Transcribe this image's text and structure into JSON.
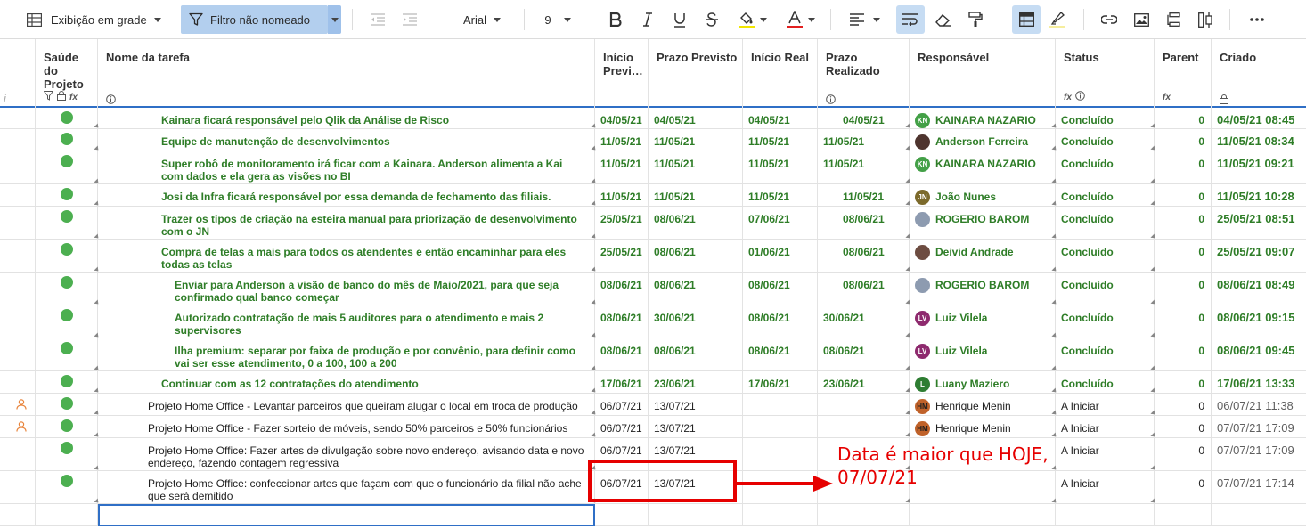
{
  "toolbar": {
    "view_label": "Exibição em grade",
    "filter_label": "Filtro não nomeado",
    "font_name": "Arial",
    "font_size": "9"
  },
  "columns": {
    "health": "Saúde do Projeto",
    "task": "Nome da tarefa",
    "inicio_previsto": "Início Previ…",
    "prazo_previsto": "Prazo Previsto",
    "inicio_real": "Início Real",
    "prazo_realizado": "Prazo Realizado",
    "responsavel": "Responsável",
    "status": "Status",
    "parent": "Parent",
    "criado": "Criado"
  },
  "colors": {
    "green_text": "#2e7d27",
    "health_green": "#4caf50",
    "selection_blue": "#2f6fc6",
    "annotation_red": "#e60000"
  },
  "rows": [
    {
      "task": "Kainara ficará responsável pelo Qlik da Análise de Risco",
      "indent": 1,
      "ip": "04/05/21",
      "pp": "04/05/21",
      "ir": "04/05/21",
      "pr": "04/05/21",
      "resp": "KAINARA NAZARIO",
      "initials": "KN",
      "avatar_color": "#43a047",
      "status": "Concluído",
      "parent": "0",
      "created": "04/05/21 08:45",
      "style": "green",
      "height": 24,
      "user_icon": false
    },
    {
      "task": "Equipe de manutenção de desenvolvimentos",
      "indent": 1,
      "ip": "11/05/21",
      "pp": "11/05/21",
      "ir": "11/05/21",
      "pr": "11/05/21",
      "resp": "Anderson Ferreira",
      "initials": "",
      "avatar_color": "#4e342e",
      "status": "Concluído",
      "parent": "0",
      "created": "11/05/21 08:34",
      "style": "green",
      "height": 25,
      "user_icon": false
    },
    {
      "task": "Super robô de monitoramento irá ficar com a Kainara. Anderson alimenta a Kai com dados e ela gera as visões no BI",
      "indent": 1,
      "ip": "11/05/21",
      "pp": "11/05/21",
      "ir": "11/05/21",
      "pr": "11/05/21",
      "resp": "KAINARA NAZARIO",
      "initials": "KN",
      "avatar_color": "#43a047",
      "status": "Concluído",
      "parent": "0",
      "created": "11/05/21 09:21",
      "style": "green",
      "height": 37,
      "user_icon": false
    },
    {
      "task": "Josi da Infra ficará responsável por essa demanda de fechamento das filiais.",
      "indent": 1,
      "ip": "11/05/21",
      "pp": "11/05/21",
      "ir": "11/05/21",
      "pr": "11/05/21",
      "resp": "João Nunes",
      "initials": "JN",
      "avatar_color": "#7c6a2c",
      "status": "Concluído",
      "parent": "0",
      "created": "11/05/21 10:28",
      "style": "green",
      "height": 25,
      "user_icon": false
    },
    {
      "task": "Trazer os tipos de criação na esteira manual para priorização de desenvolvimento com o JN",
      "indent": 1,
      "ip": "25/05/21",
      "pp": "08/06/21",
      "ir": "07/06/21",
      "pr": "08/06/21",
      "resp": "ROGERIO BAROM",
      "initials": "",
      "avatar_color": "#8d9bb0",
      "status": "Concluído",
      "parent": "0",
      "created": "25/05/21 08:51",
      "style": "green",
      "height": 37,
      "user_icon": false
    },
    {
      "task": "Compra de telas a mais para todos os atendentes e então encaminhar para eles todas as telas",
      "indent": 1,
      "ip": "25/05/21",
      "pp": "08/06/21",
      "ir": "01/06/21",
      "pr": "08/06/21",
      "resp": "Deivid Andrade",
      "initials": "",
      "avatar_color": "#6d4c41",
      "status": "Concluído",
      "parent": "0",
      "created": "25/05/21 09:07",
      "style": "green",
      "height": 37,
      "user_icon": false
    },
    {
      "task": "Enviar para Anderson a visão de banco do mês de Maio/2021, para que seja confirmado qual banco começar",
      "indent": 2,
      "ip": "08/06/21",
      "pp": "08/06/21",
      "ir": "08/06/21",
      "pr": "08/06/21",
      "resp": "ROGERIO BAROM",
      "initials": "",
      "avatar_color": "#8d9bb0",
      "status": "Concluído",
      "parent": "0",
      "created": "08/06/21 08:49",
      "style": "green",
      "height": 37,
      "user_icon": false
    },
    {
      "task": "Autorizado contratação de mais 5 auditores para o atendimento e mais 2 supervisores",
      "indent": 2,
      "ip": "08/06/21",
      "pp": "30/06/21",
      "ir": "08/06/21",
      "pr": "30/06/21",
      "resp": "Luiz Vilela",
      "initials": "LV",
      "avatar_color": "#8e2a6e",
      "status": "Concluído",
      "parent": "0",
      "created": "08/06/21 09:15",
      "style": "green",
      "height": 37,
      "user_icon": false
    },
    {
      "task": "Ilha premium: separar por faixa de produção e por convênio, para definir como vai ser esse atendimento, 0 a 100, 100 a 200",
      "indent": 2,
      "ip": "08/06/21",
      "pp": "08/06/21",
      "ir": "08/06/21",
      "pr": "08/06/21",
      "resp": "Luiz Vilela",
      "initials": "LV",
      "avatar_color": "#8e2a6e",
      "status": "Concluído",
      "parent": "0",
      "created": "08/06/21 09:45",
      "style": "green",
      "height": 37,
      "user_icon": false
    },
    {
      "task": "Continuar com as 12 contratações do atendimento",
      "indent": 1,
      "ip": "17/06/21",
      "pp": "23/06/21",
      "ir": "17/06/21",
      "pr": "23/06/21",
      "resp": "Luany Maziero",
      "initials": "L",
      "avatar_color": "#2e7d32",
      "status": "Concluído",
      "parent": "0",
      "created": "17/06/21 13:33",
      "style": "green",
      "height": 25,
      "user_icon": false
    },
    {
      "task": "Projeto Home Office - Levantar parceiros que queiram alugar o local em troca de produção",
      "indent": 0,
      "ip": "06/07/21",
      "pp": "13/07/21",
      "ir": "",
      "pr": "",
      "resp": "Henrique Menin",
      "initials": "HM",
      "avatar_color": "#c0622a",
      "status": "A Iniciar",
      "parent": "0",
      "created": "06/07/21 11:38",
      "style": "normal",
      "height": 25,
      "user_icon": true
    },
    {
      "task": "Projeto Home Office - Fazer sorteio de móveis, sendo 50% parceiros e 50% funcionários",
      "indent": 0,
      "ip": "06/07/21",
      "pp": "13/07/21",
      "ir": "",
      "pr": "",
      "resp": "Henrique Menin",
      "initials": "HM",
      "avatar_color": "#c0622a",
      "status": "A Iniciar",
      "parent": "0",
      "created": "07/07/21 17:09",
      "style": "normal",
      "height": 25,
      "user_icon": true
    },
    {
      "task": "Projeto Home Office: Fazer artes de divulgação sobre novo endereço, avisando data e novo endereço, fazendo contagem regressiva",
      "indent": 0,
      "ip": "06/07/21",
      "pp": "13/07/21",
      "ir": "",
      "pr": "",
      "resp": "",
      "initials": "",
      "avatar_color": "",
      "status": "A Iniciar",
      "parent": "0",
      "created": "07/07/21 17:09",
      "style": "normal",
      "height": 37,
      "user_icon": false
    },
    {
      "task": "Projeto Home Office: confeccionar artes que façam com que o funcionário da filial não ache que será demitido",
      "indent": 0,
      "ip": "06/07/21",
      "pp": "13/07/21",
      "ir": "",
      "pr": "",
      "resp": "",
      "initials": "",
      "avatar_color": "",
      "status": "A Iniciar",
      "parent": "0",
      "created": "07/07/21 17:14",
      "style": "normal",
      "height": 37,
      "user_icon": false
    }
  ],
  "annotation": {
    "text_line1": "Data é maior que HOJE,",
    "text_line2": "07/07/21"
  }
}
